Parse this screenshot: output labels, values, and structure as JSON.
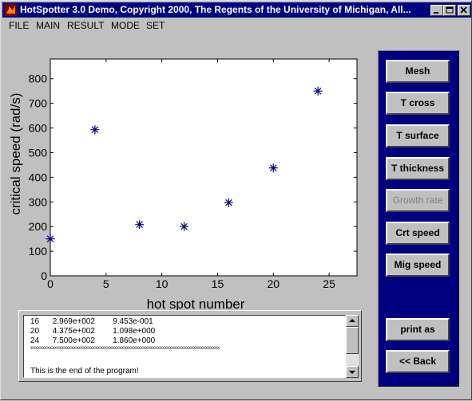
{
  "window": {
    "title": "HotSpotter 3.0 Demo,  Copyright 2000,  The Regents of the University of Michigan,  All..."
  },
  "menu": [
    "FILE",
    "MAIN",
    "RESULT",
    "MODE",
    "SET"
  ],
  "chart_data": {
    "type": "scatter",
    "marker": "asterisk",
    "color": "#000080",
    "x": [
      0,
      4,
      8,
      12,
      16,
      20,
      24
    ],
    "y": [
      150,
      593,
      208,
      200,
      297,
      438,
      750
    ],
    "xlabel": "hot spot number",
    "ylabel": "critical speed (rad/s)",
    "xlim": [
      0,
      27.5
    ],
    "ylim": [
      0,
      880
    ],
    "xticks": [
      "0",
      "5",
      "10",
      "15",
      "20",
      "25"
    ],
    "yticks": [
      "0",
      "100",
      "200",
      "300",
      "400",
      "500",
      "600",
      "700",
      "800"
    ],
    "grid": false
  },
  "output_text": [
    "16      2.969e+002        9.453e-001",
    "20      4.375e+002        1.098e+000",
    "24      7.500e+002        1.860e+000",
    "xxxxxxxxxxxxxxxxxxxxxxxxxxxxxxxxxxxxxxxxxxxxxxxxxxxxxxxxxxxxxxxxxxxxxxxxxxxxxxx",
    "",
    "This is the end of the program!"
  ],
  "buttons": [
    {
      "label": "Mesh",
      "enabled": true
    },
    {
      "label": "T cross",
      "enabled": true
    },
    {
      "label": "T surface",
      "enabled": true
    },
    {
      "label": "T thickness",
      "enabled": true
    },
    {
      "label": "Growth rate",
      "enabled": false
    },
    {
      "label": "Crt speed",
      "enabled": true
    },
    {
      "label": "Mig speed",
      "enabled": true
    }
  ],
  "bottom_buttons": [
    {
      "label": "print as"
    },
    {
      "label": "<< Back"
    }
  ]
}
